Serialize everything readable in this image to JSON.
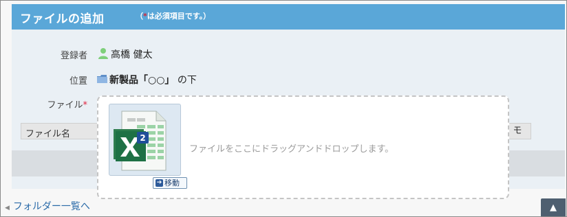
{
  "header": {
    "title": "ファイルの追加",
    "required_note_open": "（",
    "required_star": "*",
    "required_note_text": "は必須項目です。）"
  },
  "form": {
    "registrant_label": "登録者",
    "registrant_name": "高橋 健太",
    "location_label": "位置",
    "location_folder": "新製品「○○」",
    "location_suffix": " の下",
    "file_label": "ファイル",
    "file_required_star": "*"
  },
  "file_table": {
    "col_name": "ファイル名",
    "col_memo": "モ"
  },
  "dropzone": {
    "hint": "ファイルをここにドラッグアンドドロップします。",
    "dragged_file_icon": "excel-file-icon",
    "dragged_file_count": "2",
    "move_label": "移動"
  },
  "footer": {
    "back_link": "フォルダー一覧へ",
    "scroll_top_icon": "▲"
  },
  "colors": {
    "header": "#5aa7d8",
    "required_star": "#e0223d",
    "link": "#2a6aa8",
    "excel_green": "#1e7145"
  }
}
